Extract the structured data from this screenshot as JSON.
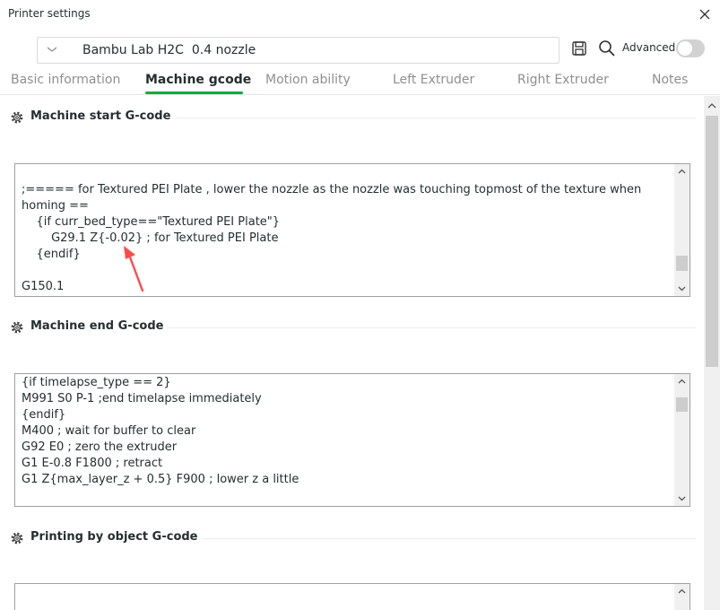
{
  "window": {
    "title": "Printer settings"
  },
  "preset": {
    "name": "Bambu Lab H2C  0.4 nozzle"
  },
  "toolbar": {
    "advanced_label": "Advanced"
  },
  "tabs": [
    {
      "label": "Basic information"
    },
    {
      "label": "Machine gcode"
    },
    {
      "label": "Motion ability"
    },
    {
      "label": "Left Extruder"
    },
    {
      "label": "Right Extruder"
    },
    {
      "label": "Notes"
    }
  ],
  "sections": {
    "start": {
      "title": "Machine start G-code",
      "lines": [
        "",
        ";===== for Textured PEI Plate , lower the nozzle as the nozzle was touching topmost of the texture when homing ==",
        "    {if curr_bed_type==\"Textured PEI Plate\"}",
        "        G29.1 Z{-0.02} ; for Textured PEI Plate",
        "    {endif}",
        "",
        "G150.1"
      ]
    },
    "end": {
      "title": "Machine end G-code",
      "lines": [
        "{if timelapse_type == 2}",
        "M991 S0 P-1 ;end timelapse immediately",
        "{endif}",
        "M400 ; wait for buffer to clear",
        "G92 E0 ; zero the extruder",
        "G1 E-0.8 F1800 ; retract",
        "G1 Z{max_layer_z + 0.5} F900 ; lower z a little"
      ]
    },
    "object": {
      "title": "Printing by object G-code",
      "lines": []
    }
  },
  "colors": {
    "accent": "#00ae42",
    "annotation": "#ff4b4b"
  }
}
